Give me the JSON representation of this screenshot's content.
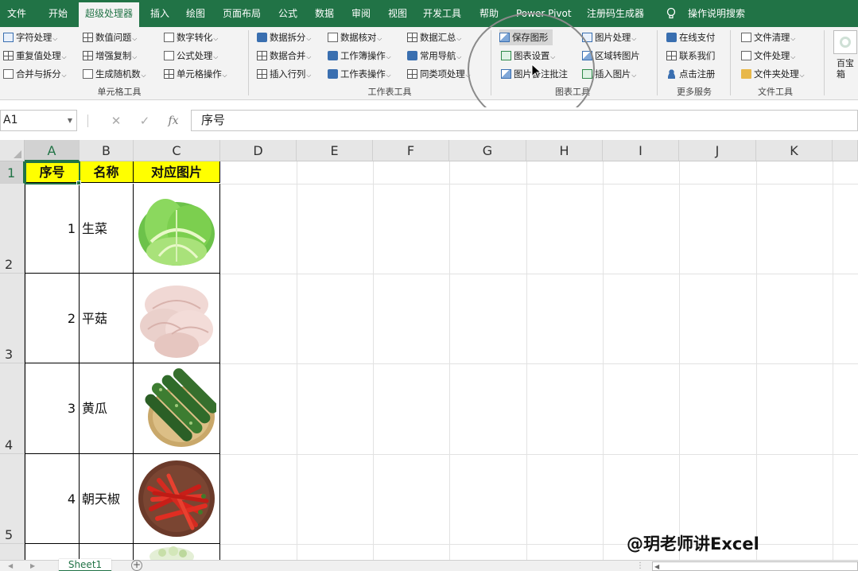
{
  "menu": {
    "tabs": [
      "文件",
      "开始",
      "超级处理器",
      "插入",
      "绘图",
      "页面布局",
      "公式",
      "数据",
      "审阅",
      "视图",
      "开发工具",
      "帮助",
      "Power Pivot",
      "注册码生成器",
      "操作说明搜索"
    ],
    "active_tab": "超级处理器"
  },
  "ribbon": {
    "cell_tools": {
      "label": "单元格工具",
      "items": [
        "字符处理",
        "重复值处理",
        "合并与拆分",
        "数值问题",
        "增强复制",
        "生成随机数",
        "数字转化",
        "公式处理",
        "单元格操作"
      ]
    },
    "sheet_tools": {
      "label": "工作表工具",
      "items": [
        "数据拆分",
        "数据合并",
        "插入行列",
        "数据核对",
        "工作簿操作",
        "工作表操作",
        "数据汇总",
        "常用导航",
        "同类项处理"
      ]
    },
    "chart_tools": {
      "label": "图表工具",
      "items": [
        "保存图形",
        "图表设置",
        "图片备注批注",
        "图片处理",
        "区域转图片",
        "插入图片"
      ]
    },
    "more_services": {
      "label": "更多服务",
      "items": [
        "在线支付",
        "联系我们",
        "点击注册"
      ]
    },
    "file_tools": {
      "label": "文件工具",
      "items": [
        "文件清理",
        "文件处理",
        "文件夹处理"
      ]
    },
    "extra": [
      "百宝",
      "箱"
    ]
  },
  "formula_bar": {
    "name_box": "A1",
    "cancel": "✕",
    "enter": "✓",
    "fx": "fx",
    "content": "序号"
  },
  "grid": {
    "columns": [
      "A",
      "B",
      "C",
      "D",
      "E",
      "F",
      "G",
      "H",
      "I",
      "J",
      "K"
    ],
    "rows": [
      "1",
      "2",
      "3",
      "4",
      "5"
    ],
    "selected_cell": "A1",
    "header": [
      "序号",
      "名称",
      "对应图片"
    ],
    "data": [
      {
        "no": "1",
        "name": "生菜",
        "image": "lettuce"
      },
      {
        "no": "2",
        "name": "平菇",
        "image": "oyster-mushroom"
      },
      {
        "no": "3",
        "name": "黄瓜",
        "image": "cucumber"
      },
      {
        "no": "4",
        "name": "朝天椒",
        "image": "chili-pepper"
      }
    ]
  },
  "sheets": {
    "tabs": [
      "Sheet1"
    ],
    "active": "Sheet1",
    "add": "+"
  },
  "watermark": "@玥老师讲Excel",
  "colors": {
    "brand_green": "#217346",
    "header_fill": "#ffff00"
  }
}
